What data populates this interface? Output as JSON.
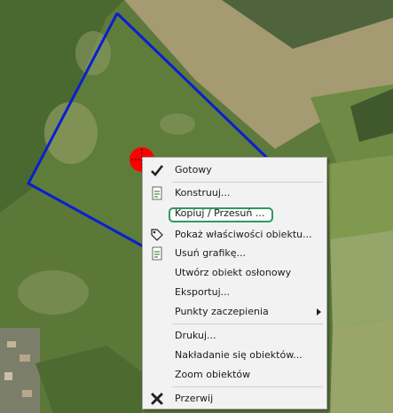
{
  "map": {
    "polygon_color": "#0a1fd0",
    "marker_color": "#ff0000"
  },
  "context_menu": {
    "items": [
      {
        "label": "Gotowy",
        "icon": "checkmark-icon"
      },
      {
        "label": "Konstruuj...",
        "icon": "document-icon"
      },
      {
        "label": "Kopiuj / Przesuń ...",
        "icon": "",
        "highlighted": true
      },
      {
        "label": "Pokaż właściwości obiektu...",
        "icon": "tag-icon"
      },
      {
        "label": "Usuń grafikę...",
        "icon": "document-icon"
      },
      {
        "label": "Utwórz obiekt osłonowy",
        "icon": ""
      },
      {
        "label": "Eksportuj...",
        "icon": ""
      },
      {
        "label": "Punkty zaczepienia",
        "icon": "",
        "submenu": true
      },
      {
        "label": "Drukuj...",
        "icon": ""
      },
      {
        "label": "Nakładanie się obiektów...",
        "icon": ""
      },
      {
        "label": "Zoom obiektów",
        "icon": ""
      },
      {
        "label": "Przerwij",
        "icon": "close-x-icon"
      }
    ],
    "highlight_color": "#2e9a5e"
  }
}
